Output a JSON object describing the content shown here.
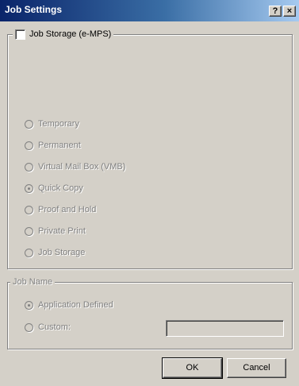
{
  "window": {
    "title": "Job Settings",
    "help_button": "?",
    "close_button": "×"
  },
  "job_storage_group": {
    "checkbox_label": "Job Storage (e-MPS)",
    "checkbox_checked": false,
    "options": [
      {
        "label": "Temporary",
        "selected": false
      },
      {
        "label": "Permanent",
        "selected": false
      },
      {
        "label": "Virtual Mail Box (VMB)",
        "selected": false
      },
      {
        "label": "Quick Copy",
        "selected": true
      },
      {
        "label": "Proof and Hold",
        "selected": false
      },
      {
        "label": "Private Print",
        "selected": false
      },
      {
        "label": "Job Storage",
        "selected": false
      }
    ]
  },
  "job_name_group": {
    "legend": "Job Name",
    "options": [
      {
        "label": "Application Defined",
        "selected": true
      },
      {
        "label": "Custom:",
        "selected": false
      }
    ],
    "custom_value": ""
  },
  "buttons": {
    "ok": "OK",
    "cancel": "Cancel"
  }
}
